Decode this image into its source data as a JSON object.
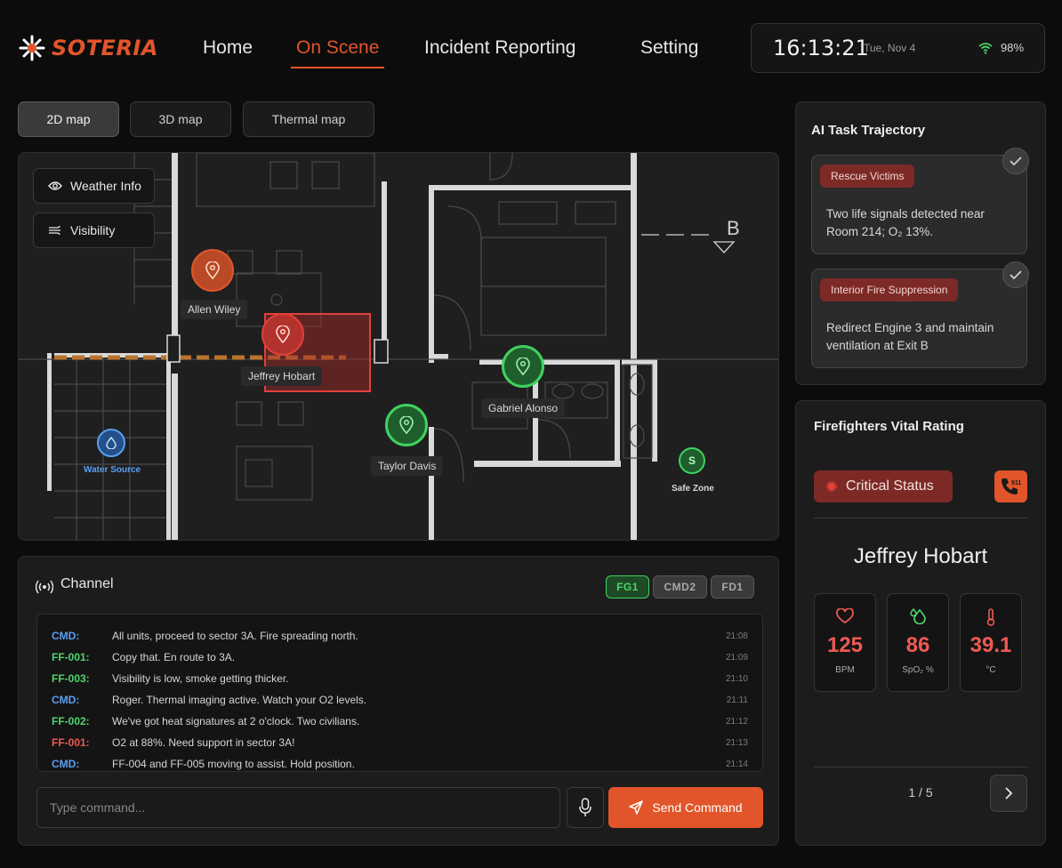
{
  "brand": {
    "name": "SOTERIA"
  },
  "nav": {
    "items": [
      {
        "label": "Home"
      },
      {
        "label": "On Scene"
      },
      {
        "label": "Incident Reporting"
      },
      {
        "label": "Setting"
      }
    ],
    "active": "On Scene"
  },
  "status": {
    "time": "16:13:21",
    "date": "Tue, Nov 4",
    "battery": "98%"
  },
  "map_tabs": [
    {
      "label": "2D map"
    },
    {
      "label": "3D map"
    },
    {
      "label": "Thermal map"
    }
  ],
  "map": {
    "weather_label": "Weather Info",
    "visibility_label": "Visibility",
    "marker_b": "B",
    "firefighters": [
      {
        "name": "Allen Wiley",
        "status": "warning"
      },
      {
        "name": "Jeffrey Hobart",
        "status": "critical"
      },
      {
        "name": "Gabriel Alonso",
        "status": "ok"
      },
      {
        "name": "Taylor Davis",
        "status": "ok"
      }
    ],
    "water_source_label": "Water Source",
    "safe_zone_letter": "S",
    "safe_zone_label": "Safe Zone"
  },
  "channel": {
    "title": "Channel",
    "chips": [
      {
        "label": "FG1",
        "active": true
      },
      {
        "label": "CMD2",
        "active": false
      },
      {
        "label": "FD1",
        "active": false
      }
    ],
    "messages": [
      {
        "who": "CMD:",
        "color": "#5aa0f2",
        "text": "All units, proceed to sector 3A. Fire spreading north.",
        "time": "21:08"
      },
      {
        "who": "FF-001:",
        "color": "#4fd46a",
        "text": "Copy that. En route to 3A.",
        "time": "21:09"
      },
      {
        "who": "FF-003:",
        "color": "#4fd46a",
        "text": "Visibility is low, smoke getting thicker.",
        "time": "21:10"
      },
      {
        "who": "CMD:",
        "color": "#5aa0f2",
        "text": "Roger. Thermal imaging active. Watch your O2 levels.",
        "time": "21:11"
      },
      {
        "who": "FF-002:",
        "color": "#4fd46a",
        "text": "We've got heat signatures at 2 o'clock. Two civilians.",
        "time": "21:12"
      },
      {
        "who": "FF-001:",
        "color": "#ee5a52",
        "text": "O2 at 88%. Need support in sector 3A!",
        "time": "21:13"
      },
      {
        "who": "CMD:",
        "color": "#5aa0f2",
        "text": "FF-004 and FF-005 moving to assist. Hold position.",
        "time": "21:14"
      }
    ],
    "input_placeholder": "Type command...",
    "send_label": "Send Command"
  },
  "tasks": {
    "title": "AI Task Trajectory",
    "items": [
      {
        "tag": "Rescue Victims",
        "text": "Two life signals detected near Room 214; O₂ 13%."
      },
      {
        "tag": "Interior Fire Suppression",
        "text": "Redirect Engine 3 and maintain ventilation at Exit B"
      }
    ]
  },
  "vitals": {
    "title": "Firefighters Vital Rating",
    "status_label": "Critical Status",
    "call_label": "911",
    "name": "Jeffrey Hobart",
    "cards": [
      {
        "value": "125",
        "unit": "BPM",
        "icon": "heart-icon"
      },
      {
        "value": "86",
        "unit": "SpO₂ %",
        "icon": "oxygen-drop-icon"
      },
      {
        "value": "39.1",
        "unit": "°C",
        "icon": "thermometer-icon"
      }
    ],
    "pager": "1 / 5"
  },
  "colors": {
    "accent": "#e2552a",
    "critical": "#ee5a52",
    "ok": "#4fd46a",
    "info": "#5aa0f2"
  }
}
